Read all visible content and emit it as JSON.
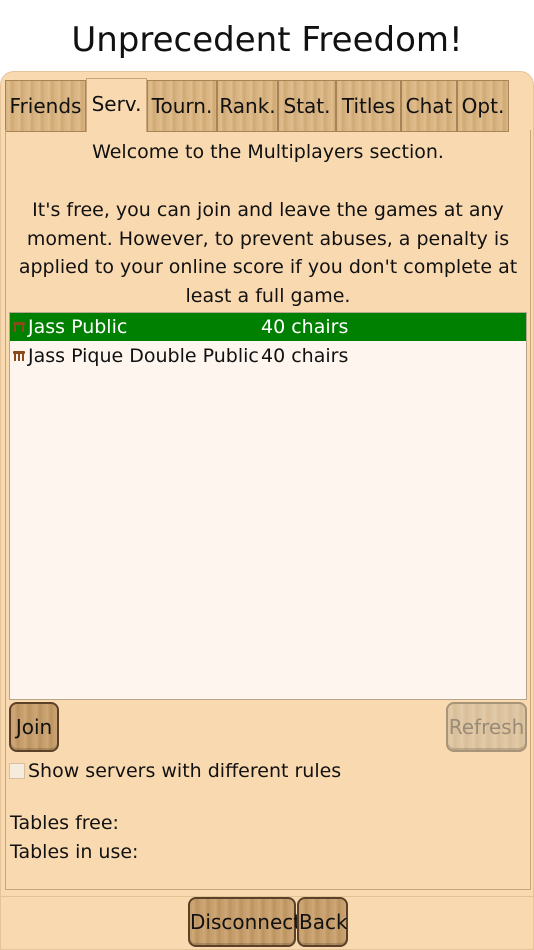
{
  "app": {
    "title": "Unprecedent Freedom!"
  },
  "tabs": [
    {
      "label": "Friends",
      "active": false
    },
    {
      "label": "Serv.",
      "active": true
    },
    {
      "label": "Tourn.",
      "active": false
    },
    {
      "label": "Rank.",
      "active": false
    },
    {
      "label": "Stat.",
      "active": false
    },
    {
      "label": "Titles",
      "active": false
    },
    {
      "label": "Chat",
      "active": false
    },
    {
      "label": "Opt.",
      "active": false
    }
  ],
  "section": {
    "welcome": "Welcome to the Multiplayers section.",
    "intro": "It's free, you can join and leave the games at any moment. However, to prevent abuses, a penalty is applied to your online score if you don't complete at least a full game."
  },
  "servers": [
    {
      "name": "Jass Public",
      "chairs": "40 chairs",
      "selected": true
    },
    {
      "name": "Jass Pique Double Public",
      "chairs": "40 chairs",
      "selected": false
    }
  ],
  "actions": {
    "join_label": "Join",
    "refresh_label": "Refresh"
  },
  "options": {
    "show_different_rules_label": "Show servers with different rules",
    "show_different_rules_checked": false
  },
  "stats": {
    "tables_free_label": "Tables free:",
    "tables_in_use_label": "Tables in use:"
  },
  "footer": {
    "disconnect_label": "Disconnect",
    "back_label": "Back"
  },
  "colors": {
    "panel": "#f9d9b0",
    "selected_row": "#008000",
    "list_bg": "#fdf5ee",
    "server_icon": "#8b4a1c"
  },
  "icons": {
    "server": "table-chairs-icon"
  }
}
